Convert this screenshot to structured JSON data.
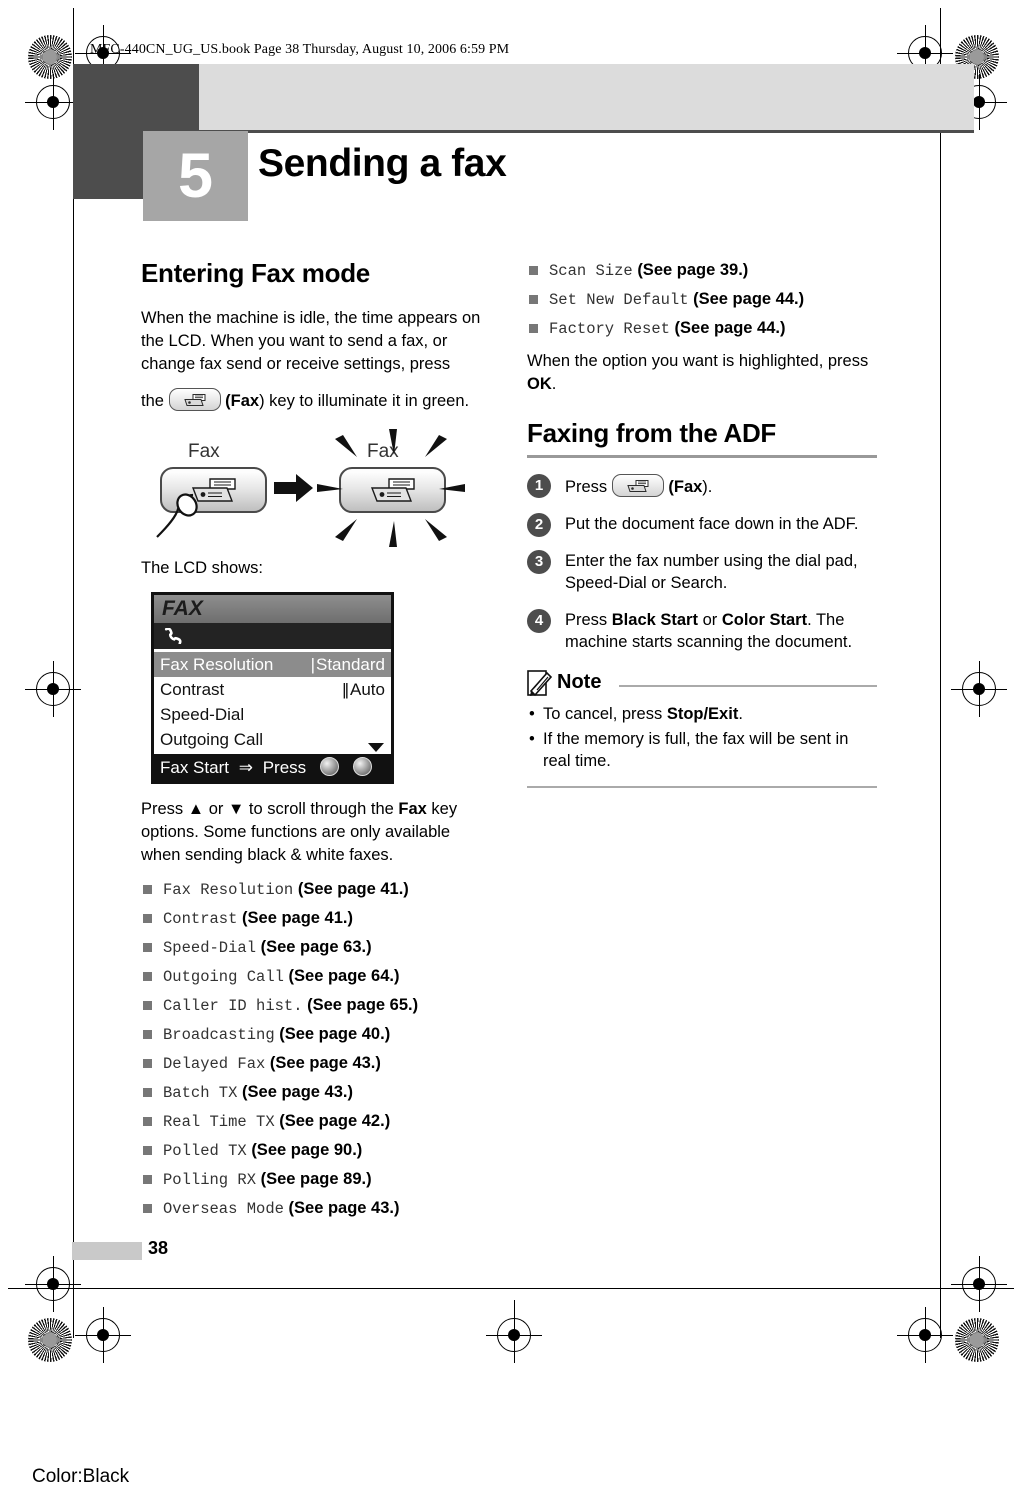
{
  "print_header": {
    "text": "MFC-440CN_UG_US.book  Page 38  Thursday, August 10, 2006  6:59 PM"
  },
  "chapter": {
    "number": "5",
    "title": "Sending a fax"
  },
  "left_column": {
    "section_title": "Entering Fax mode",
    "intro_part1": "When the machine is idle, the time appears on the LCD. When you want to send a fax, or change fax send or receive settings, press",
    "intro_line_prefix": "the",
    "intro_key_label": "Fax",
    "intro_line_suffix": ") key to illuminate it in green.",
    "illustration": {
      "label_before": "Fax",
      "label_after": "Fax",
      "key_icon": "fax-machine-icon",
      "arrow_icon": "right-arrow-icon"
    },
    "lcd_caption": "The LCD shows:",
    "lcd": {
      "title": "FAX",
      "status_icon": "phone-handset-icon",
      "rows": [
        {
          "label": "Fax Resolution",
          "value": "Standard",
          "bars": "|",
          "highlighted": true
        },
        {
          "label": "Contrast",
          "value": "Auto",
          "bars": "||",
          "highlighted": false
        },
        {
          "label": "Speed-Dial",
          "value": "",
          "bars": "",
          "highlighted": false
        },
        {
          "label": "Outgoing Call",
          "value": "",
          "bars": "",
          "highlighted": false
        }
      ],
      "scroll_icon": "chevron-down-icon",
      "footer_text": "Fax Start",
      "footer_arrow": "⇒",
      "footer_press": "Press"
    },
    "scroll_para_1": "Press ",
    "scroll_up_arrow": "▲",
    "scroll_or": " or ",
    "scroll_down_arrow": "▼",
    "scroll_para_2": " to scroll through the ",
    "scroll_key": "Fax",
    "scroll_para_3": " key options. Some functions are only available when sending black & white faxes.",
    "options": [
      {
        "name": "Fax Resolution",
        "ref": "(See page 41.)"
      },
      {
        "name": "Contrast",
        "ref": "(See page 41.)"
      },
      {
        "name": "Speed-Dial",
        "ref": "(See page 63.)"
      },
      {
        "name": "Outgoing Call",
        "ref": "(See page 64.)"
      },
      {
        "name": "Caller ID hist.",
        "ref": "(See page 65.)"
      },
      {
        "name": "Broadcasting",
        "ref": "(See page 40.)"
      },
      {
        "name": "Delayed Fax",
        "ref": "(See page 43.)"
      },
      {
        "name": "Batch TX",
        "ref": "(See page 43.)"
      },
      {
        "name": "Real Time TX",
        "ref": "(See page 42.)"
      },
      {
        "name": "Polled TX",
        "ref": "(See page 90.)"
      },
      {
        "name": "Polling RX",
        "ref": "(See page 89.)"
      },
      {
        "name": "Overseas Mode",
        "ref": "(See page 43.)"
      }
    ]
  },
  "right_column": {
    "options_continued": [
      {
        "name": "Scan Size",
        "ref": "(See page 39.)"
      },
      {
        "name": "Set New Default",
        "ref": "(See page 44.)"
      },
      {
        "name": "Factory Reset",
        "ref": "(See page 44.)"
      }
    ],
    "highlight_note_1": "When the option you want is highlighted, press ",
    "highlight_note_key": "OK",
    "highlight_note_2": ".",
    "section_title": "Faxing from the ADF",
    "steps": [
      {
        "num": "1",
        "prefix": "Press ",
        "key_icon": "fax-machine-icon",
        "bold": "Fax",
        "suffix": ")."
      },
      {
        "num": "2",
        "text": "Put the document face down in the ADF."
      },
      {
        "num": "3",
        "text": "Enter the fax number using the dial pad, Speed-Dial or Search."
      },
      {
        "num": "4",
        "prefix": "Press ",
        "bold1": "Black Start",
        "mid": " or ",
        "bold2": "Color Start",
        "suffix": ". The machine starts scanning the document."
      }
    ],
    "note": {
      "icon": "note-pencil-icon",
      "title": "Note",
      "items": [
        {
          "prefix": "To cancel, press ",
          "bold": "Stop/Exit",
          "suffix": "."
        },
        {
          "prefix": "If the memory is full, the fax will be sent in real time.",
          "bold": "",
          "suffix": ""
        }
      ]
    }
  },
  "footer": {
    "page_number": "38",
    "color_label": "Color:Black"
  }
}
